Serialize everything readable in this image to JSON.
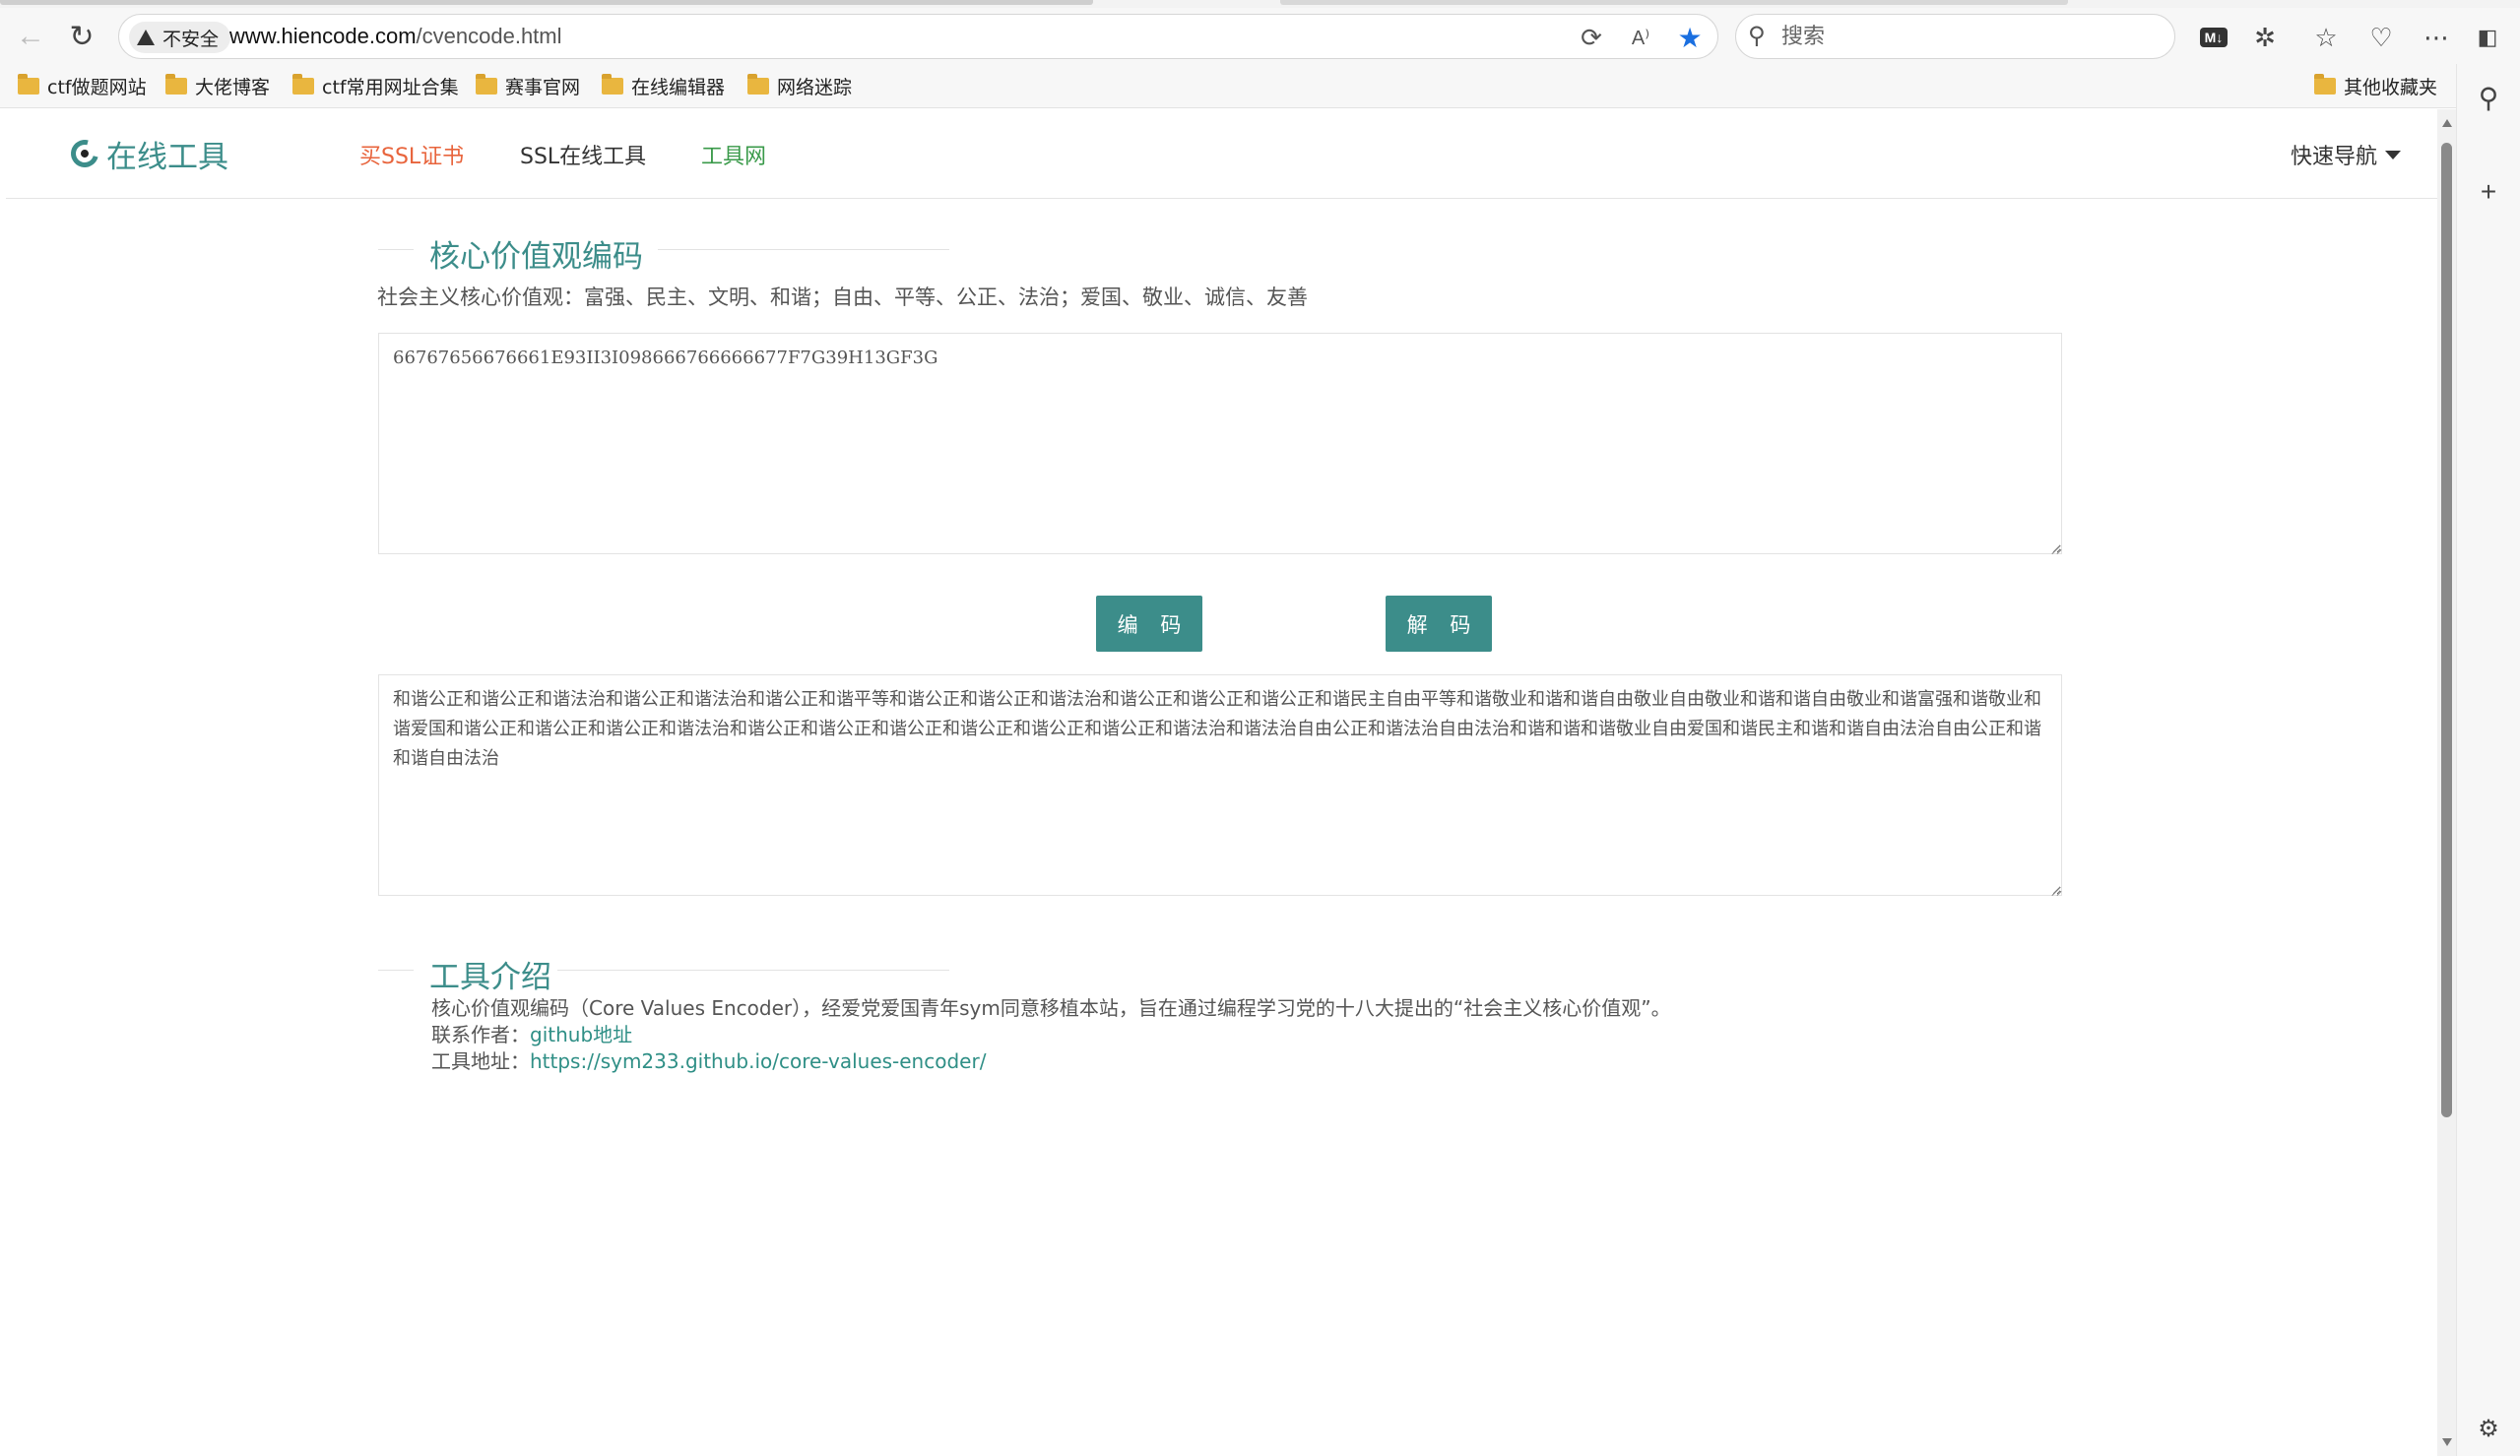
{
  "browser": {
    "insecure_label": "不安全",
    "url_host": "www.hiencode.com",
    "url_path": "/cvencode.html",
    "search_placeholder": "搜索",
    "bookmarks": [
      "ctf做题网站",
      "大佬博客",
      "ctf常用网址合集",
      "赛事官网",
      "在线编辑器",
      "网络迷踪"
    ],
    "other_bookmarks": "其他收藏夹",
    "md_badge": "M↓"
  },
  "site": {
    "logo_text": "在线工具",
    "nav": {
      "buy_ssl": "买SSL证书",
      "ssl_tools": "SSL在线工具",
      "tool_net": "工具网",
      "quick_nav": "快速导航"
    }
  },
  "main": {
    "title": "核心价值观编码",
    "subtitle": "社会主义核心价值观：富强、民主、文明、和谐；自由、平等、公正、法治；爱国、敬业、诚信、友善",
    "input_value": "66767656676661E93II3I098666766666677F7G39H13GF3G",
    "encode_label": "编 码",
    "decode_label": "解 码",
    "output_value": "和谐公正和谐公正和谐法治和谐公正和谐法治和谐公正和谐平等和谐公正和谐公正和谐法治和谐公正和谐公正和谐公正和谐民主自由平等和谐敬业和谐和谐自由敬业自由敬业和谐和谐自由敬业和谐富强和谐敬业和谐爱国和谐公正和谐公正和谐公正和谐法治和谐公正和谐公正和谐公正和谐公正和谐公正和谐公正和谐法治和谐法治自由公正和谐法治自由法治和谐和谐和谐敬业自由爱国和谐民主和谐和谐自由法治自由公正和谐和谐自由法治"
  },
  "intro": {
    "title": "工具介绍",
    "description": "核心价值观编码（Core Values Encoder），经爱党爱国青年sym同意移植本站，旨在通过编程学习党的十八大提出的“社会主义核心价值观”。",
    "contact_label": "联系作者：",
    "contact_link": "github地址",
    "address_label": "工具地址：",
    "address_link": "https://sym233.github.io/core-values-encoder/"
  },
  "colors": {
    "accent": "#3c8d8a",
    "buy_ssl": "#e8643c",
    "tool_net": "#3a9a4a",
    "star": "#1a6fe0"
  },
  "icons": [
    "back-arrow-icon",
    "refresh-icon",
    "warning-icon",
    "translate-icon",
    "read-aloud-icon",
    "favorite-star-icon",
    "search-icon",
    "extensions-icon",
    "favorites-icon",
    "browser-essentials-icon",
    "more-icon",
    "sidebar-toggle-icon",
    "folder-icon",
    "add-icon",
    "settings-gear-icon"
  ]
}
